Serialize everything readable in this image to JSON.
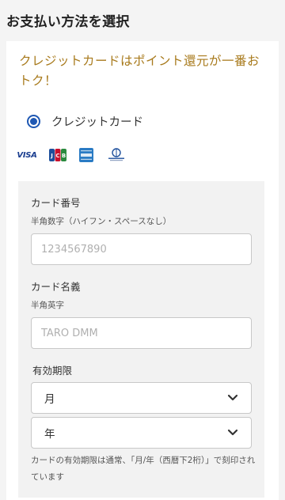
{
  "page": {
    "title": "お支払い方法を選択"
  },
  "promo": {
    "text": "クレジットカードはポイント還元が一番おトク！"
  },
  "payment_option": {
    "label": "クレジットカード",
    "selected": true
  },
  "brands": [
    {
      "name": "VISA",
      "icon": "visa-icon"
    },
    {
      "name": "JCB",
      "icon": "jcb-icon"
    },
    {
      "name": "AMERICAN EXPRESS",
      "icon": "amex-icon"
    },
    {
      "name": "Diners Club",
      "icon": "diners-icon"
    }
  ],
  "form": {
    "card_number": {
      "label": "カード番号",
      "hint": "半角数字（ハイフン・スペースなし）",
      "placeholder": "1234567890",
      "value": ""
    },
    "card_name": {
      "label": "カード名義",
      "hint": "半角英字",
      "placeholder": "TARO DMM",
      "value": ""
    },
    "expiry": {
      "label": "有効期限",
      "month_selected": "月",
      "year_selected": "年",
      "note": "カードの有効期限は通常、「月/年（西暦下2桁）」で刻印されています"
    }
  },
  "colors": {
    "accent_gold": "#a87a1c",
    "radio_blue": "#1f58b3",
    "page_bg": "#f4f4f4",
    "panel_bg": "#f2f2f2"
  }
}
